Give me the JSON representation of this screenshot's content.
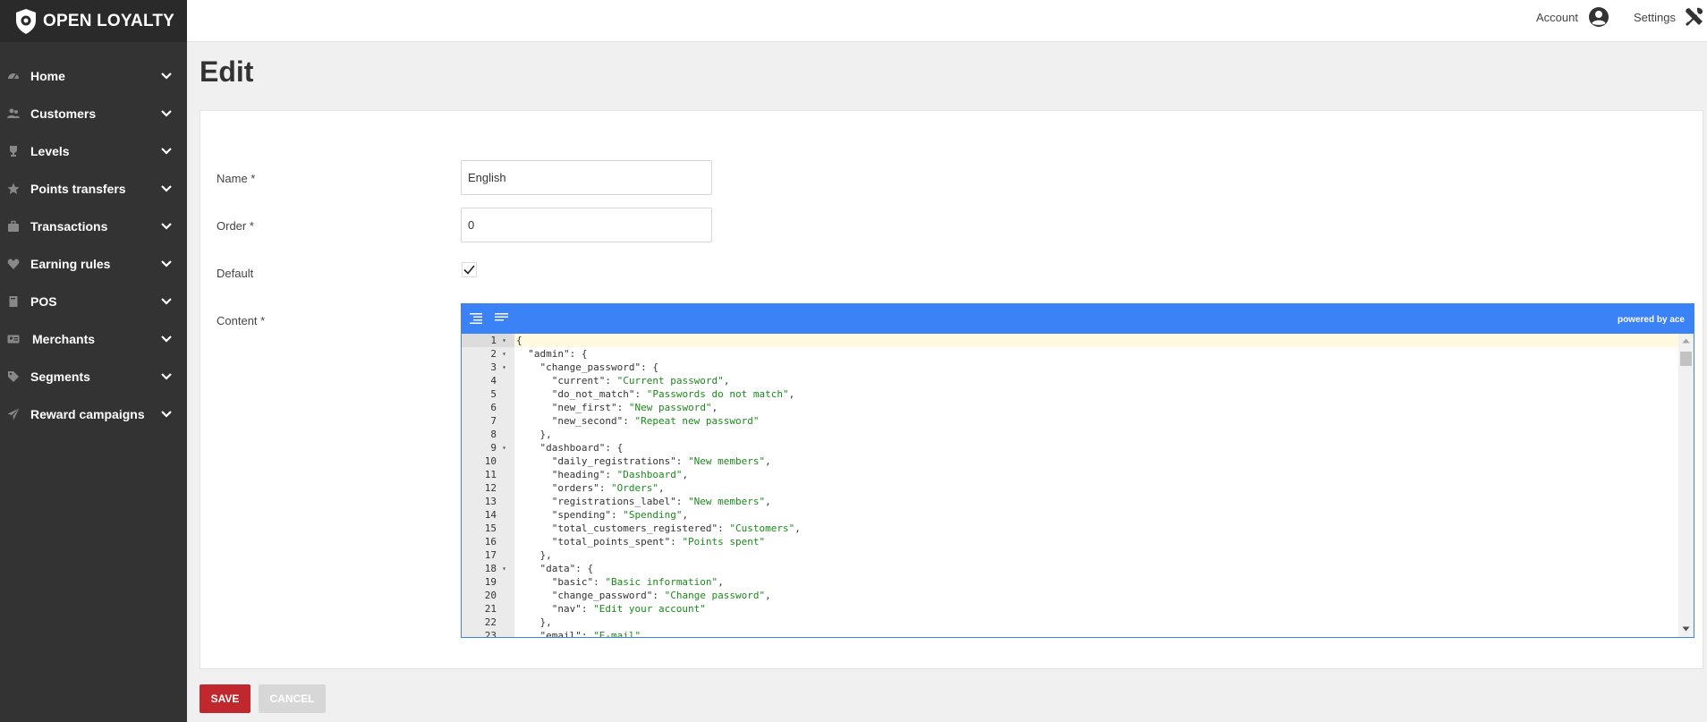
{
  "app": {
    "brand": "OPEN LOYALTY",
    "brand_icon": "shield-logo-icon"
  },
  "sidebar": {
    "items": [
      {
        "label": "Home",
        "icon": "dashboard-icon"
      },
      {
        "label": "Customers",
        "icon": "users-icon"
      },
      {
        "label": "Levels",
        "icon": "trophy-icon"
      },
      {
        "label": "Points transfers",
        "icon": "star-icon"
      },
      {
        "label": "Transactions",
        "icon": "briefcase-icon"
      },
      {
        "label": "Earning rules",
        "icon": "heart-icon"
      },
      {
        "label": "POS",
        "icon": "book-icon"
      },
      {
        "label": "Merchants",
        "icon": "id-card-icon"
      },
      {
        "label": "Segments",
        "icon": "tag-icon"
      },
      {
        "label": "Reward campaigns",
        "icon": "paper-plane-icon"
      }
    ]
  },
  "topbar": {
    "account_label": "Account",
    "settings_label": "Settings"
  },
  "page": {
    "title": "Edit"
  },
  "form": {
    "name_label": "Name *",
    "name_value": "English",
    "order_label": "Order *",
    "order_value": "0",
    "default_label": "Default",
    "default_checked": true,
    "content_label": "Content *"
  },
  "editor": {
    "powered_by": "powered by ace",
    "active_line": 1,
    "lines": [
      "{",
      "  \"admin\": {",
      "    \"change_password\": {",
      "      \"current\": \"Current password\",",
      "      \"do_not_match\": \"Passwords do not match\",",
      "      \"new_first\": \"New password\",",
      "      \"new_second\": \"Repeat new password\"",
      "    },",
      "    \"dashboard\": {",
      "      \"daily_registrations\": \"New members\",",
      "      \"heading\": \"Dashboard\",",
      "      \"orders\": \"Orders\",",
      "      \"registrations_label\": \"New members\",",
      "      \"spending\": \"Spending\",",
      "      \"total_customers_registered\": \"Customers\",",
      "      \"total_points_spent\": \"Points spent\"",
      "    },",
      "    \"data\": {",
      "      \"basic\": \"Basic information\",",
      "      \"change_password\": \"Change password\",",
      "      \"nav\": \"Edit your account\"",
      "    },",
      "    \"email\": \"E-mail\","
    ],
    "fold_lines": [
      1,
      2,
      3,
      9,
      18
    ]
  },
  "actions": {
    "save_label": "SAVE",
    "cancel_label": "CANCEL"
  },
  "colors": {
    "sidebar_bg": "#333333",
    "accent_blue": "#3b82f6",
    "save_red": "#c0282d",
    "string_green": "#1a8a1a"
  }
}
